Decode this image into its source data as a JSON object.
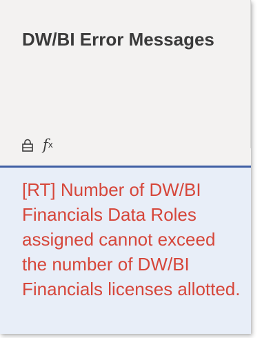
{
  "panel": {
    "title": "DW/BI Error Messages",
    "icons": [
      "lock-icon",
      "function-fx-icon"
    ],
    "fx_glyph": "f",
    "fx_sub": "x"
  },
  "message": {
    "text": "[RT] Number of DW/BI Financials Data Roles assigned cannot exceed the number of DW/BI Financials licenses allotted."
  },
  "colors": {
    "title": "#3a3a3a",
    "error_text": "#d6463a",
    "divider": "#3f5fa4",
    "body_bg": "#e8eef8",
    "header_bg": "#f3f2f1"
  }
}
